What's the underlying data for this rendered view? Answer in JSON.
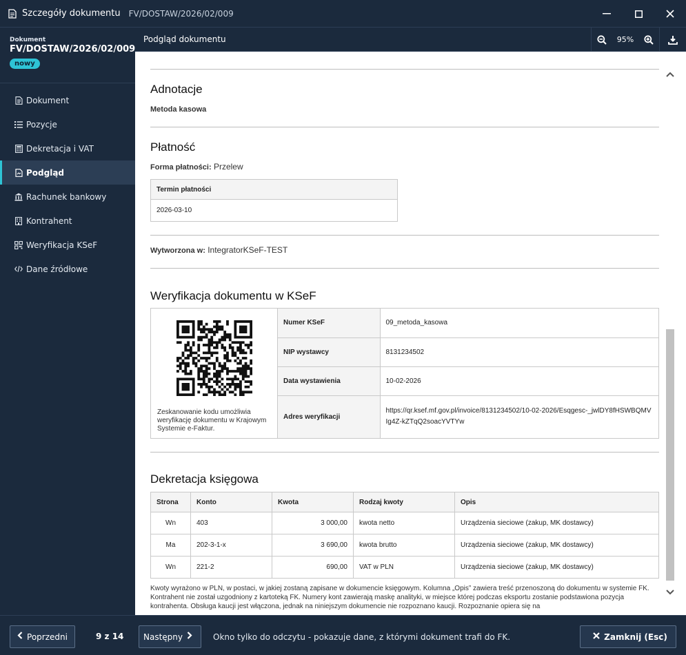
{
  "window": {
    "title": "Szczegóły dokumentu",
    "doc_number": "FV/DOSTAW/2026/02/009"
  },
  "sidebar": {
    "label": "Dokument",
    "number": "FV/DOSTAW/2026/02/009",
    "badge": "nowy",
    "items": [
      {
        "label": "Dokument",
        "icon": "document-icon"
      },
      {
        "label": "Pozycje",
        "icon": "list-icon"
      },
      {
        "label": "Dekretacja i VAT",
        "icon": "calculator-icon"
      },
      {
        "label": "Podgląd",
        "icon": "preview-icon",
        "active": true
      },
      {
        "label": "Rachunek bankowy",
        "icon": "bank-icon"
      },
      {
        "label": "Kontrahent",
        "icon": "building-icon"
      },
      {
        "label": "Weryfikacja KSeF",
        "icon": "qr-icon"
      },
      {
        "label": "Dane źródłowe",
        "icon": "code-icon"
      }
    ]
  },
  "header": {
    "title": "Podgląd dokumentu",
    "zoom": "95%"
  },
  "document": {
    "adnotacje": {
      "heading": "Adnotacje",
      "metoda": "Metoda kasowa"
    },
    "platnosc": {
      "heading": "Płatność",
      "forma_label": "Forma płatności:",
      "forma_value": "Przelew",
      "termin_header": "Termin płatności",
      "termin_value": "2026-03-10"
    },
    "wytworzona": {
      "label": "Wytworzona w:",
      "value": "IntegratorKSeF-TEST"
    },
    "ksef": {
      "heading": "Weryfikacja dokumentu w KSeF",
      "qr_caption": "Zeskanowanie kodu umożliwia weryfikację dokumentu w Krajowym Systemie e-Faktur.",
      "rows": [
        {
          "key": "Numer KSeF",
          "value": "09_metoda_kasowa"
        },
        {
          "key": "NIP wystawcy",
          "value": "8131234502"
        },
        {
          "key": "Data wystawienia",
          "value": "10-02-2026"
        },
        {
          "key": "Adres weryfikacji",
          "value": "https://qr.ksef.mf.gov.pl/invoice/8131234502/10-02-2026/Esqgesc-_jwlDY8fHSWBQMVIg4Z-kZTqQ2soacYVTYw"
        }
      ]
    },
    "dekretacja": {
      "heading": "Dekretacja księgowa",
      "columns": [
        "Strona",
        "Konto",
        "Kwota",
        "Rodzaj kwoty",
        "Opis"
      ],
      "rows": [
        [
          "Wn",
          "403",
          "3 000,00",
          "kwota netto",
          "Urządzenia sieciowe (zakup, MK dostawcy)"
        ],
        [
          "Ma",
          "202-3-1-x",
          "3 690,00",
          "kwota brutto",
          "Urządzenia sieciowe (zakup, MK dostawcy)"
        ],
        [
          "Wn",
          "221-2",
          "690,00",
          "VAT w PLN",
          "Urządzenia sieciowe (zakup, MK dostawcy)"
        ]
      ],
      "note": "Kwoty wyrażono w PLN, w postaci, w jakiej zostaną zapisane w dokumencie księgowym. Kolumna „Opis” zawiera treść przenoszoną do dokumentu w systemie FK. Kontrahent nie został uzgodniony z kartoteką FK. Numery kont zawierają maskę analityki, w miejsce której podczas eksportu zostanie podstawiona pozycja kontrahenta. Obsługa kaucji jest włączona, jednak na niniejszym dokumencie nie rozpoznano kaucji. Rozpoznanie opiera się na"
    }
  },
  "footer": {
    "prev_label": "Poprzedni",
    "pager": "9 z 14",
    "next_label": "Następny",
    "info": "Okno tylko do odczytu - pokazuje dane, z którymi dokument trafi do FK.",
    "close_label": "Zamknij (Esc)"
  }
}
